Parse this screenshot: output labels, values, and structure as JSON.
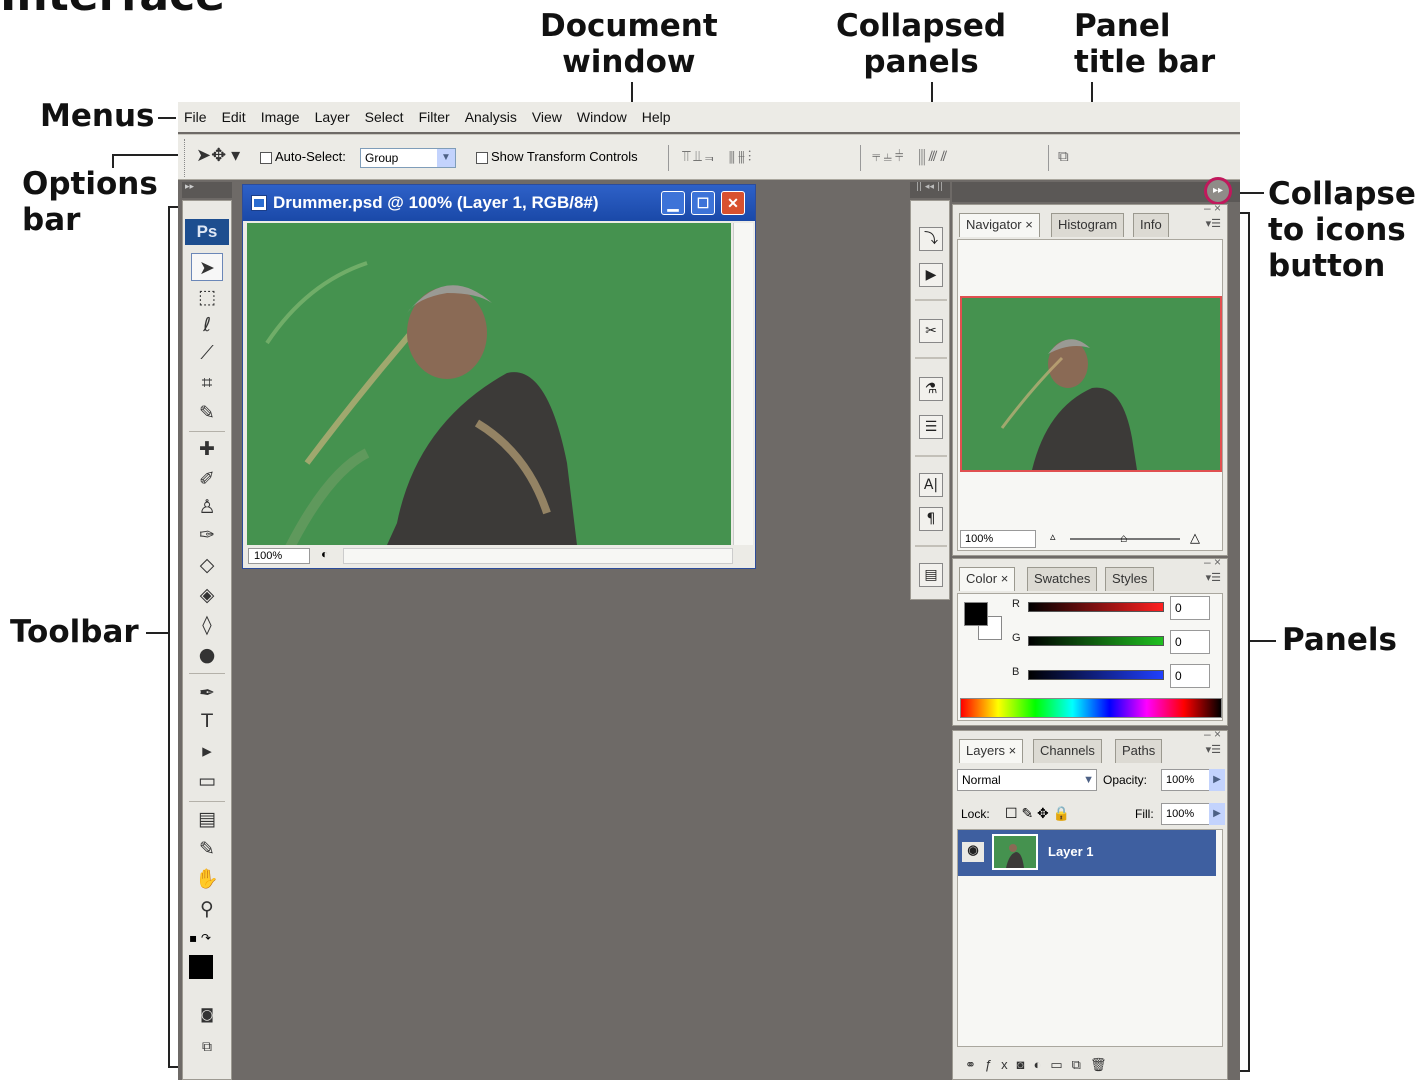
{
  "callouts": {
    "document_window": "Document\nwindow",
    "collapsed_panels": "Collapsed\npanels",
    "panel_title_bar": "Panel\ntitle bar",
    "menus": "Menus",
    "options_bar": "Options\nbar",
    "collapse_to_icons": "Collapse\nto icons\nbutton",
    "toolbar": "Toolbar",
    "panels": "Panels",
    "title_fragment": "Interface"
  },
  "menubar": [
    "File",
    "Edit",
    "Image",
    "Layer",
    "Select",
    "Filter",
    "Analysis",
    "View",
    "Window",
    "Help"
  ],
  "options": {
    "auto_select_label": "Auto-Select:",
    "auto_select_value": "Group",
    "show_transform_label": "Show Transform Controls"
  },
  "document": {
    "title": "Drummer.psd @ 100% (Layer 1, RGB/8#)",
    "zoom": "100%"
  },
  "toolbar": {
    "logo": "Ps"
  },
  "navigator": {
    "tabs": [
      "Navigator",
      "Histogram",
      "Info"
    ],
    "zoom": "100%"
  },
  "color": {
    "tabs": [
      "Color",
      "Swatches",
      "Styles"
    ],
    "channels": [
      {
        "label": "R",
        "value": "0"
      },
      {
        "label": "G",
        "value": "0"
      },
      {
        "label": "B",
        "value": "0"
      }
    ]
  },
  "layers": {
    "tabs": [
      "Layers",
      "Channels",
      "Paths"
    ],
    "blend_mode": "Normal",
    "opacity_label": "Opacity:",
    "opacity_value": "100%",
    "lock_label": "Lock:",
    "fill_label": "Fill:",
    "fill_value": "100%",
    "layer_name": "Layer 1"
  },
  "colors": {
    "canvas_green": "#45924f",
    "workspace_gray": "#6e6a67",
    "highlight_ring": "#c1185c"
  }
}
